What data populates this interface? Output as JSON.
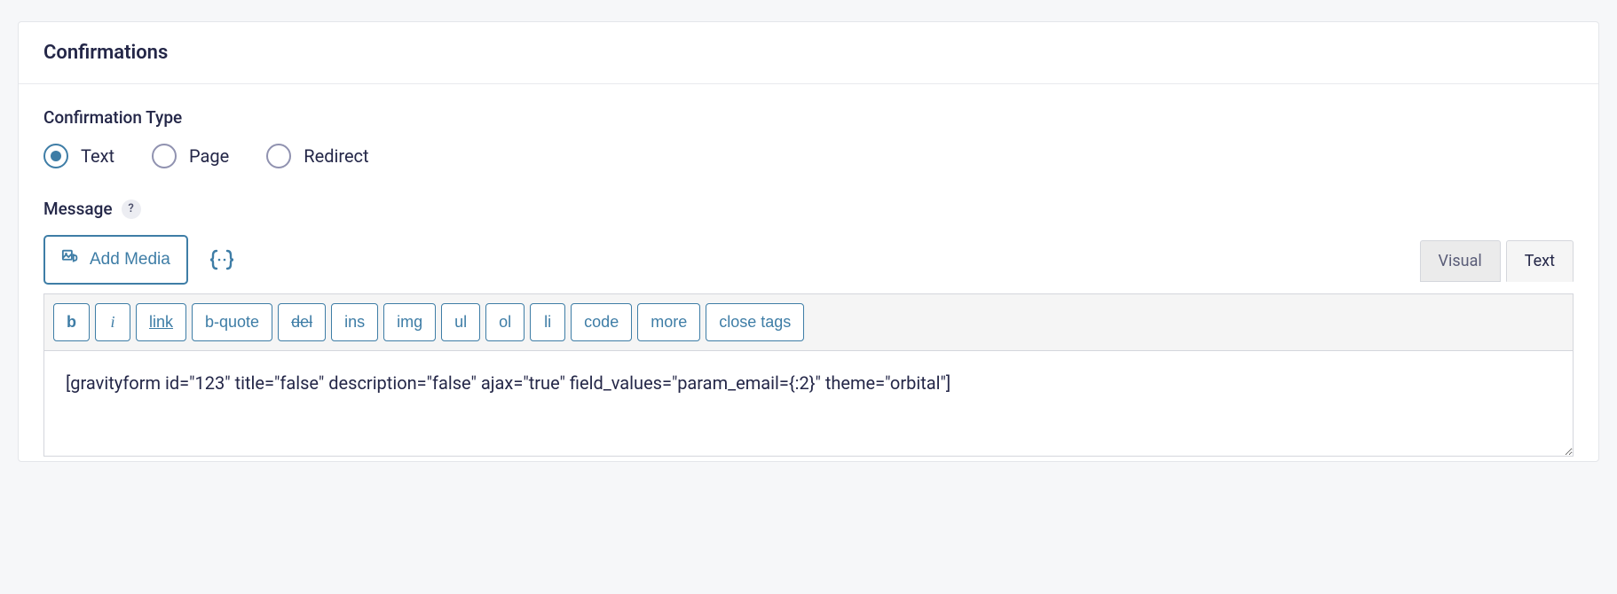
{
  "panel": {
    "title": "Confirmations"
  },
  "confirmation_type": {
    "label": "Confirmation Type",
    "options": {
      "text": "Text",
      "page": "Page",
      "redirect": "Redirect"
    },
    "selected": "text"
  },
  "message": {
    "label": "Message",
    "help": "?",
    "add_media": "Add Media"
  },
  "editor_tabs": {
    "visual": "Visual",
    "text": "Text"
  },
  "quicktags": {
    "b": "b",
    "i": "i",
    "link": "link",
    "bquote": "b-quote",
    "del": "del",
    "ins": "ins",
    "img": "img",
    "ul": "ul",
    "ol": "ol",
    "li": "li",
    "code": "code",
    "more": "more",
    "close": "close tags"
  },
  "editor_content": "[gravityform id=\"123\" title=\"false\" description=\"false\" ajax=\"true\" field_values=\"param_email={:2}\" theme=\"orbital\"]"
}
